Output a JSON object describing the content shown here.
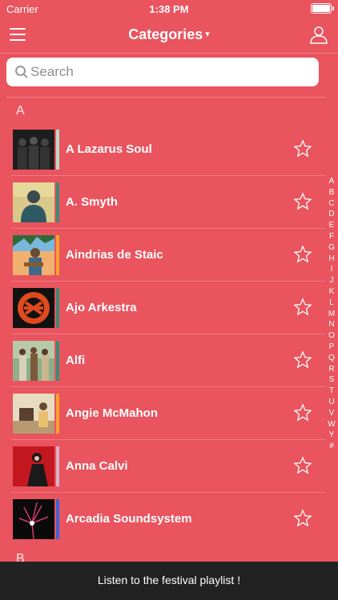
{
  "status_bar": {
    "carrier": "Carrier",
    "time": "1:38 PM",
    "battery_level": 1.0
  },
  "nav": {
    "title": "Categories",
    "caret": "▾",
    "menu_icon": "hamburger-icon",
    "user_icon": "user-icon"
  },
  "search": {
    "placeholder": "Search",
    "value": ""
  },
  "sections": [
    {
      "letter": "A",
      "rows": [
        {
          "name": "A Lazarus Soul",
          "stripe_color": "#b7dcc8",
          "starred": false
        },
        {
          "name": "A. Smyth",
          "stripe_color": "#3c8a78",
          "starred": false
        },
        {
          "name": "Aindrias de Staic",
          "stripe_color": "#f7a12c",
          "starred": false
        },
        {
          "name": "Ajo Arkestra",
          "stripe_color": "#3c8a78",
          "starred": false
        },
        {
          "name": "Alfi",
          "stripe_color": "#3c8a78",
          "starred": false
        },
        {
          "name": "Angie McMahon",
          "stripe_color": "#f7a12c",
          "starred": false
        },
        {
          "name": "Anna Calvi",
          "stripe_color": "#d9b3c8",
          "starred": false
        },
        {
          "name": "Arcadia Soundsystem",
          "stripe_color": "#3a64d6",
          "starred": false
        }
      ]
    },
    {
      "letter": "B",
      "rows": []
    }
  ],
  "index_letters": [
    "A",
    "B",
    "C",
    "D",
    "E",
    "F",
    "G",
    "H",
    "I",
    "J",
    "K",
    "L",
    "M",
    "N",
    "O",
    "P",
    "Q",
    "R",
    "S",
    "T",
    "U",
    "V",
    "W",
    "Y",
    "#"
  ],
  "banner": {
    "text": "Listen to the festival playlist !"
  },
  "colors": {
    "background": "#e9545e",
    "banner": "#222222"
  }
}
